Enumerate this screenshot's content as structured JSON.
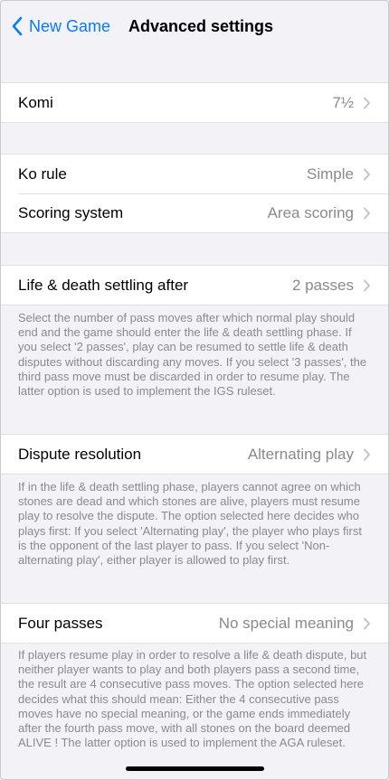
{
  "navbar": {
    "back_label": "New Game",
    "title": "Advanced settings"
  },
  "komi": {
    "label": "Komi",
    "value": "7½"
  },
  "rules": [
    {
      "label": "Ko rule",
      "value": "Simple"
    },
    {
      "label": "Scoring system",
      "value": "Area scoring"
    }
  ],
  "life_death": {
    "label": "Life & death settling after",
    "value": "2 passes",
    "footer": "Select the number of pass moves after which normal play should end and the game should enter the life & death settling phase. If you select '2 passes', play can be resumed to settle life & death disputes without discarding any moves. If you select '3 passes', the third pass move must be discarded in order to resume play. The latter option is used to implement the IGS ruleset."
  },
  "dispute": {
    "label": "Dispute resolution",
    "value": "Alternating play",
    "footer": "If in the life & death settling phase, players cannot agree on which stones are dead and which stones are alive, players must resume play to resolve the dispute. The option selected here decides who plays first: If you select 'Alternating play', the player who plays first is the opponent of the last player to pass. If you select 'Non-alternating play', either player is allowed to play first."
  },
  "four_passes": {
    "label": "Four passes",
    "value": "No special meaning",
    "footer": "If players resume play in order to resolve a life & death dispute, but neither player wants to play and both players pass a second time, the result are 4 consecutive pass moves. The option selected here decides what this should mean: Either the 4 consecutive pass moves have no special meaning, or the game ends immediately after the fourth pass move, with all stones on the board deemed ALIVE ! The latter option is used to implement the AGA ruleset."
  },
  "colors": {
    "accent": "#0a7aff",
    "background": "#f2f2f7",
    "secondary_text": "#8a8a8e"
  },
  "icons": {
    "back": "chevron-left-icon",
    "disclosure": "chevron-right-icon"
  }
}
